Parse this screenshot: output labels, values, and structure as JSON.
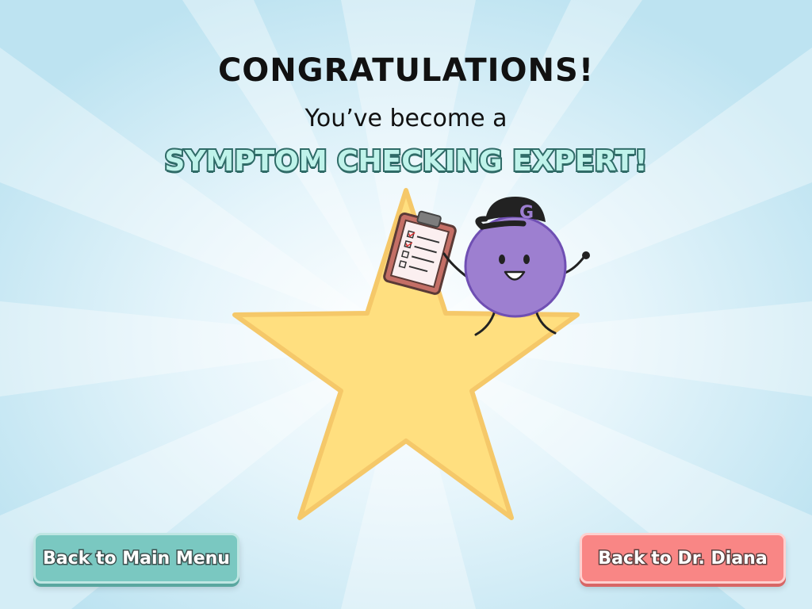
{
  "screen": {
    "title": "CONGRATULATIONS!",
    "subtitle": "You’ve become a",
    "badge": "SYMPTOM CHECKING EXPERT!"
  },
  "mascot": {
    "cap_letter": "G"
  },
  "buttons": {
    "main_menu": "Back to Main Menu",
    "dr_diana": "Back to Dr. Diana"
  },
  "colors": {
    "background": "#bfe3f1",
    "star": "#ffdf7f",
    "mascot": "#9d7fd0",
    "main_menu_button": "#7ac8c1",
    "dr_diana_button": "#f98685"
  }
}
